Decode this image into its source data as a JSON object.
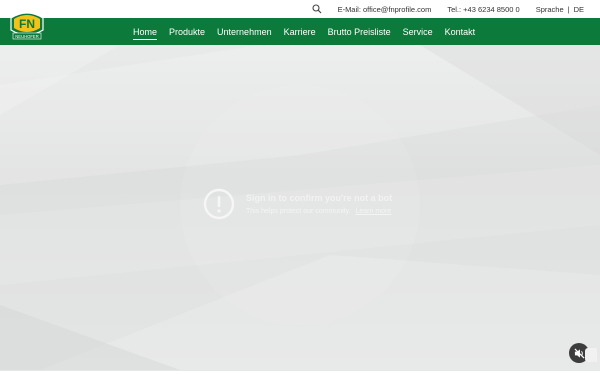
{
  "topbar": {
    "search_icon": "search-icon",
    "email": "E-Mail: office@fnprofile.com",
    "phone": "Tel.: +43 6234 8500 0",
    "language_label": "Sprache",
    "language_code": "DE"
  },
  "logo": {
    "mark": "FN",
    "caption": "NEUHOFER"
  },
  "nav": {
    "items": [
      {
        "label": "Home",
        "active": true
      },
      {
        "label": "Produkte"
      },
      {
        "label": "Unternehmen"
      },
      {
        "label": "Karriere"
      },
      {
        "label": "Brutto Preisliste"
      },
      {
        "label": "Service"
      },
      {
        "label": "Kontakt"
      }
    ]
  },
  "video": {
    "title": "Sign in to confirm you're not a bot",
    "subtitle": "This helps protect our community.",
    "learn_more": "Learn more",
    "alert_icon": "alert-circle-icon",
    "mute_icon": "muted-speaker-icon"
  },
  "colors": {
    "brand_green": "#0b7a3b",
    "logo_yellow": "#f2c21a"
  }
}
